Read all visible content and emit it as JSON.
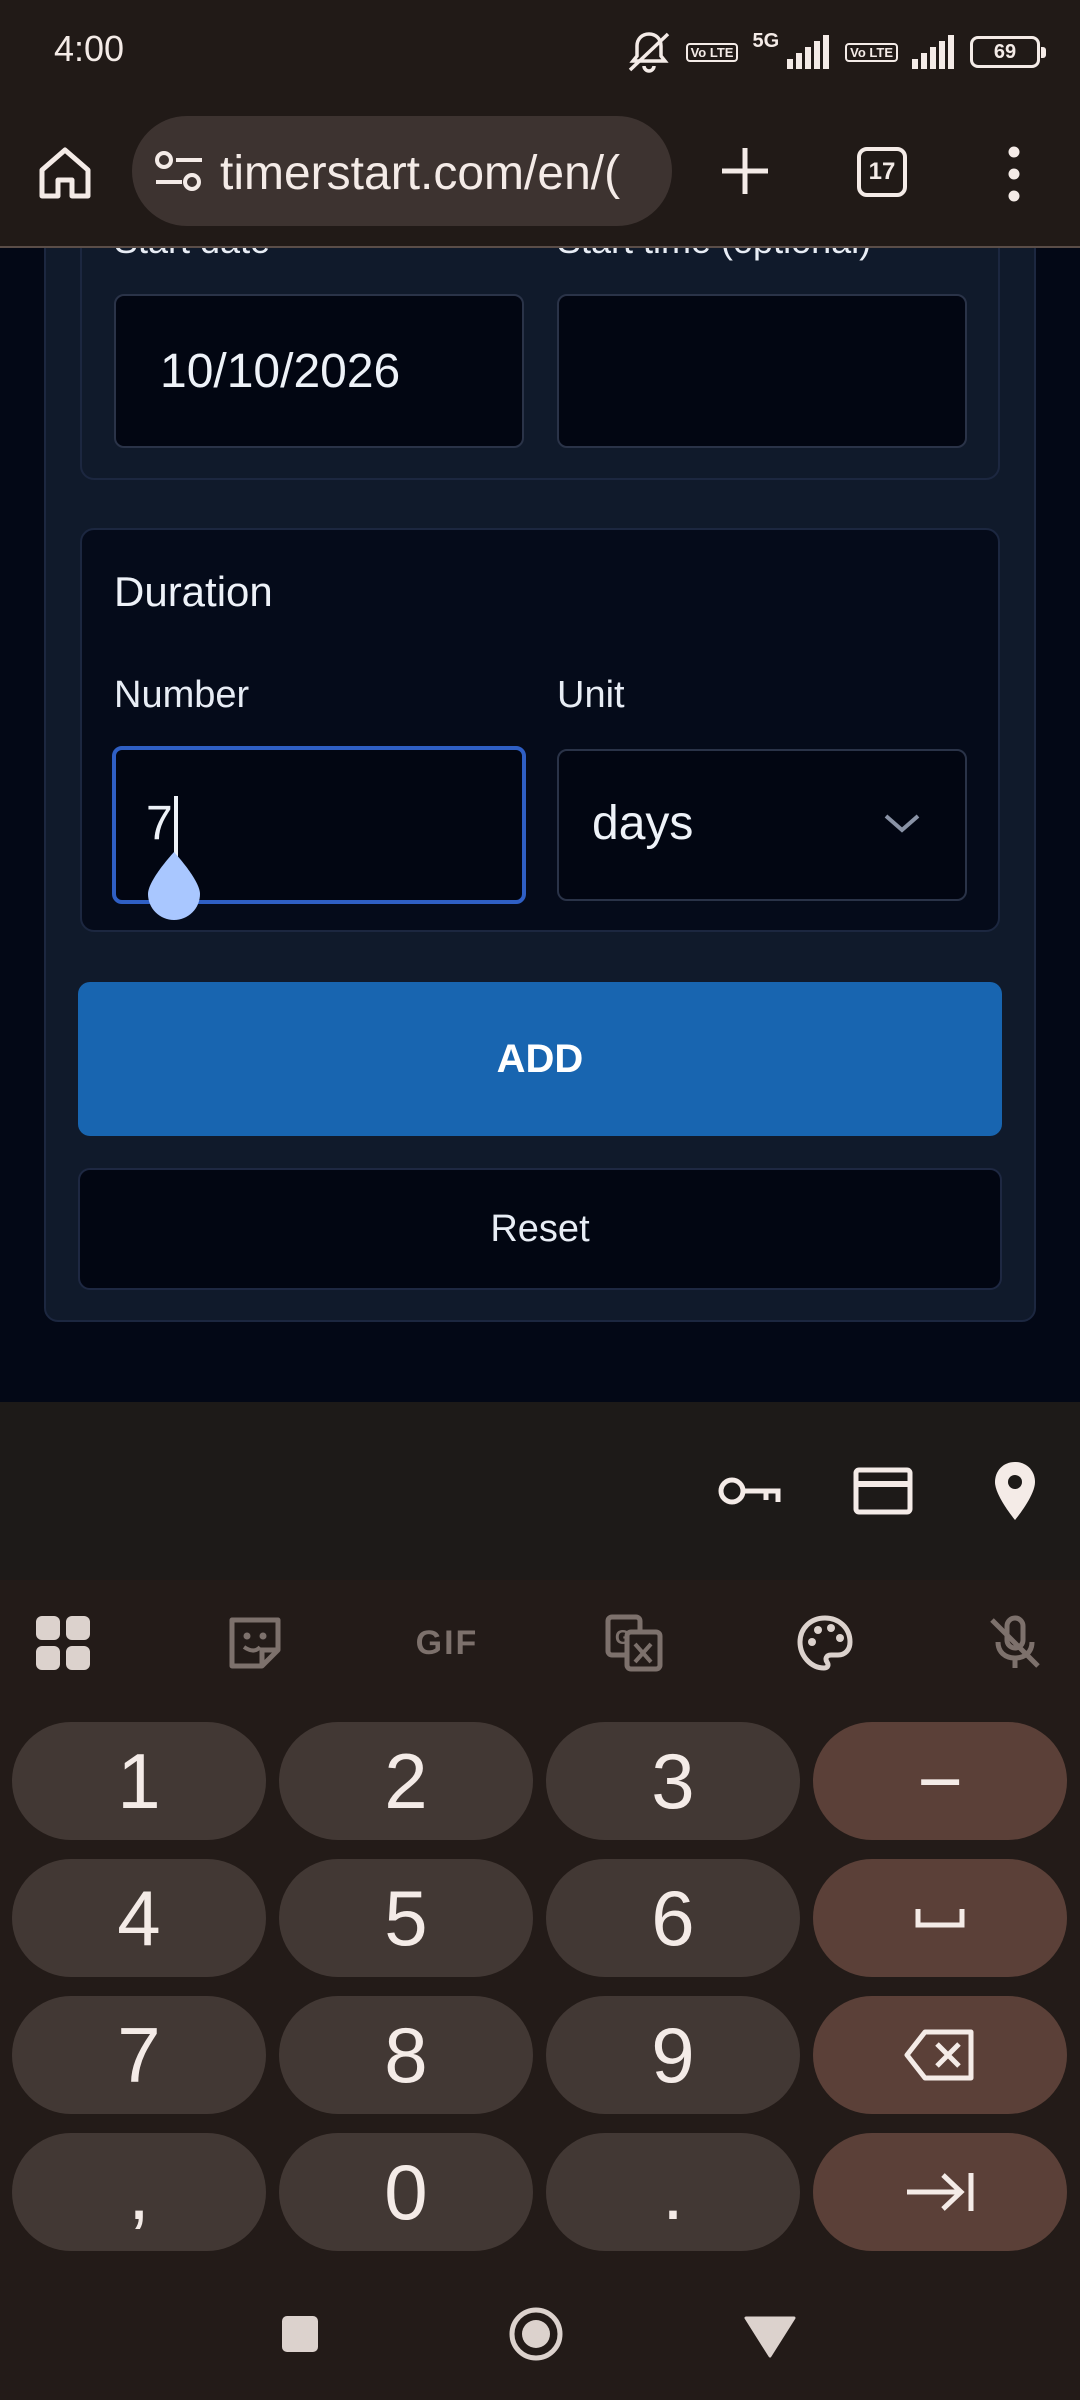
{
  "status_bar": {
    "time": "4:00",
    "network_label": "5G",
    "lte_badge_1": "Vo LTE",
    "lte_badge_2": "Vo LTE",
    "battery": "69",
    "icons": [
      "mute-vibrate-icon",
      "volte-icon",
      "signal-icon",
      "volte-icon",
      "signal-icon",
      "battery-icon"
    ]
  },
  "browser": {
    "url": "timerstart.com/en/(",
    "tab_count": "17",
    "icons": [
      "home-icon",
      "tune-icon",
      "plus-icon",
      "tabs-icon",
      "more-vert-icon"
    ]
  },
  "form": {
    "start_date_label": "Start date",
    "start_time_label": "Start time (optional)",
    "start_date_value": "10/10/2026",
    "start_time_value": "",
    "duration_title": "Duration",
    "number_label": "Number",
    "number_value": "7",
    "unit_label": "Unit",
    "unit_value": "days",
    "add_label": "ADD",
    "reset_label": "Reset"
  },
  "autofill": {
    "icons": [
      "key-icon",
      "credit-card-icon",
      "location-pin-icon"
    ]
  },
  "keyboard": {
    "toolbar": [
      "apps-grid-icon",
      "sticker-icon",
      "gif-icon",
      "translate-icon",
      "palette-icon",
      "mic-off-icon"
    ],
    "gif_label": "GIF",
    "rows": [
      [
        "1",
        "2",
        "3",
        "−"
      ],
      [
        "4",
        "5",
        "6",
        "␣"
      ],
      [
        "7",
        "8",
        "9",
        "⌫"
      ],
      [
        ",",
        "0",
        ".",
        "⇥"
      ]
    ]
  },
  "navbar": {
    "icons": [
      "recents-square-icon",
      "home-circle-icon",
      "back-triangle-icon"
    ]
  },
  "colors": {
    "page_bg": "#030816",
    "card_bg": "#101a2b",
    "accent_blue": "#1865b0",
    "focus_border": "#2f5fc4",
    "keyboard_bg": "#231b18",
    "key_bg": "#423834",
    "function_key_bg": "#5b4038"
  }
}
